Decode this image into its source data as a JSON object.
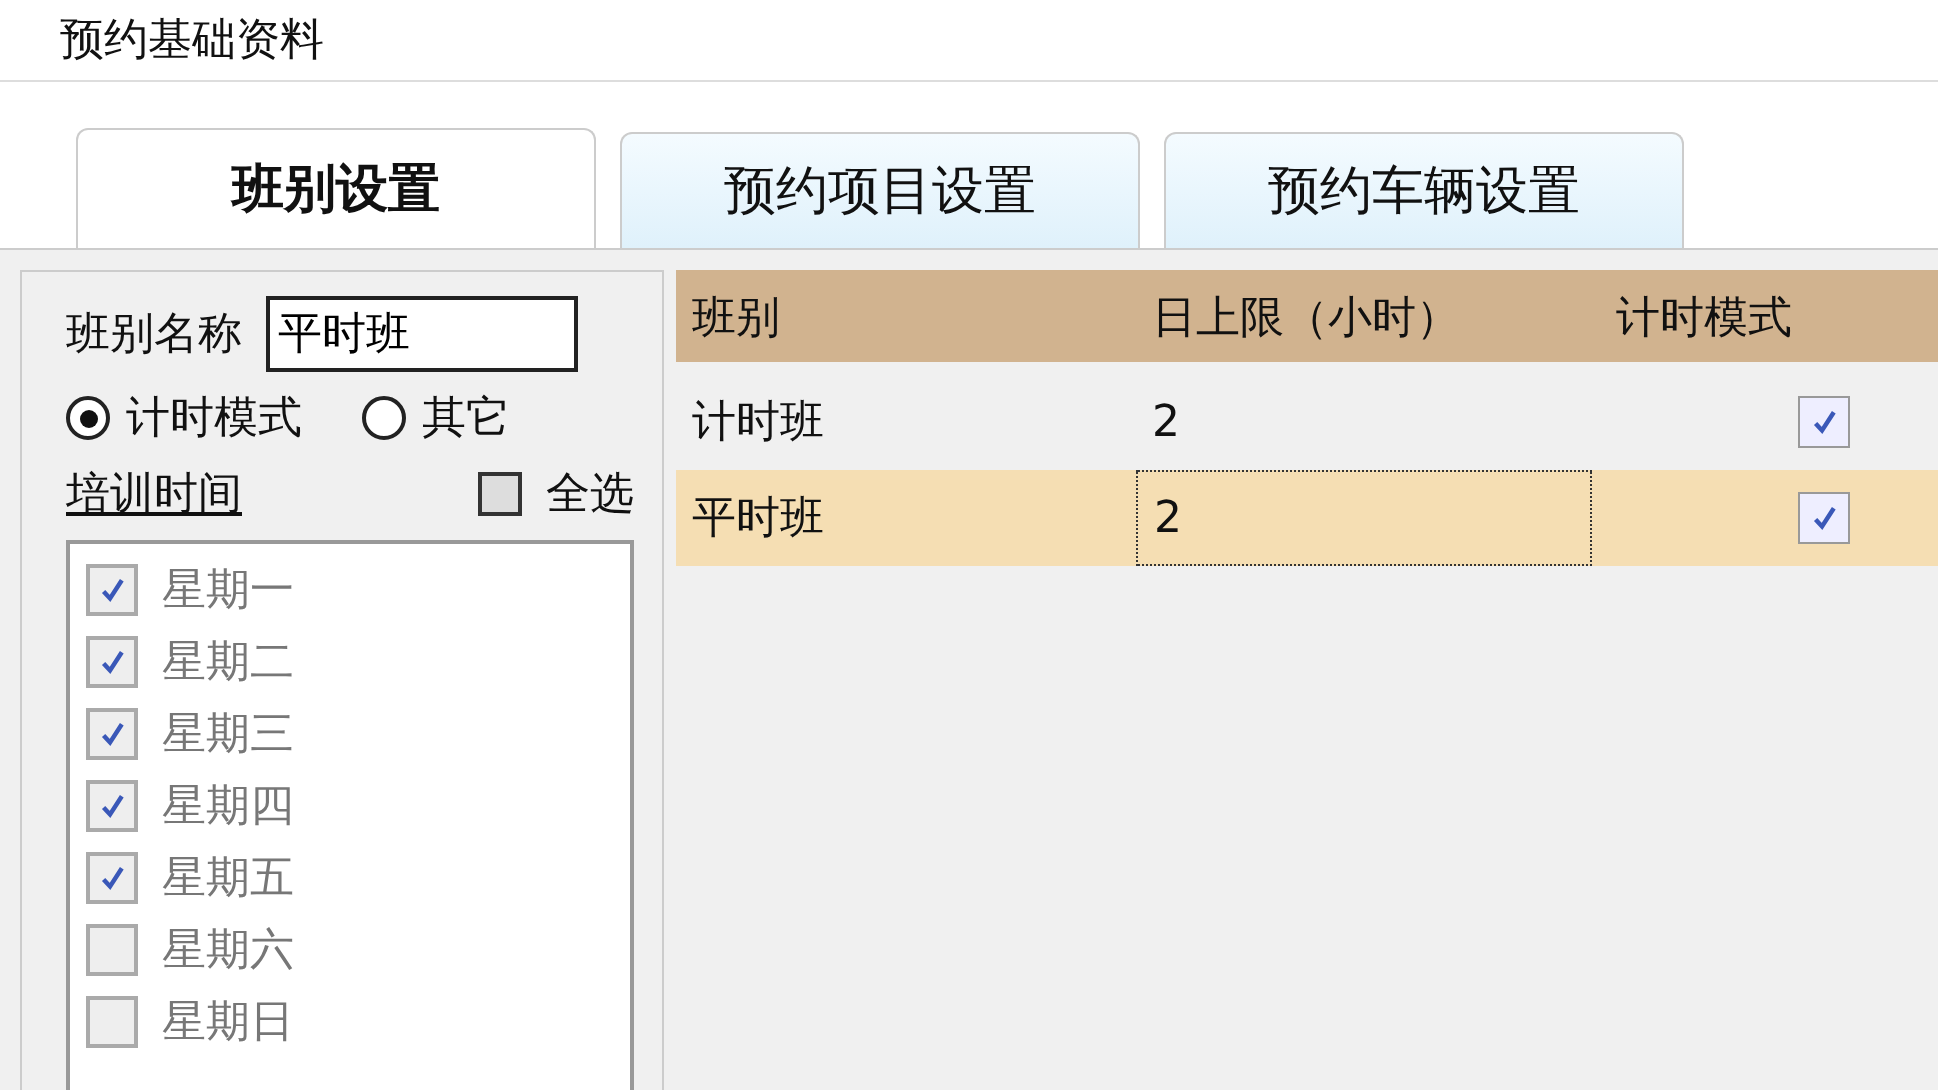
{
  "window": {
    "title": "预约基础资料"
  },
  "tabs": [
    {
      "label": "班别设置",
      "selected": true
    },
    {
      "label": "预约项目设置",
      "selected": false
    },
    {
      "label": "预约车辆设置",
      "selected": false
    }
  ],
  "form": {
    "name_label": "班别名称",
    "name_value": "平时班",
    "modes": [
      {
        "label": "计时模式",
        "selected": true
      },
      {
        "label": "其它",
        "selected": false
      }
    ],
    "training_label": "培训时间",
    "select_all": {
      "label": "全选",
      "checked": false
    },
    "days": [
      {
        "label": "星期一",
        "checked": true
      },
      {
        "label": "星期二",
        "checked": true
      },
      {
        "label": "星期三",
        "checked": true
      },
      {
        "label": "星期四",
        "checked": true
      },
      {
        "label": "星期五",
        "checked": true
      },
      {
        "label": "星期六",
        "checked": false
      },
      {
        "label": "星期日",
        "checked": false
      }
    ]
  },
  "table": {
    "columns": [
      "班别",
      "日上限（小时）",
      "计时模式"
    ],
    "rows": [
      {
        "name": "计时班",
        "limit": "2",
        "timed": true,
        "selected": false
      },
      {
        "name": "平时班",
        "limit": "2",
        "timed": true,
        "selected": true
      }
    ]
  }
}
